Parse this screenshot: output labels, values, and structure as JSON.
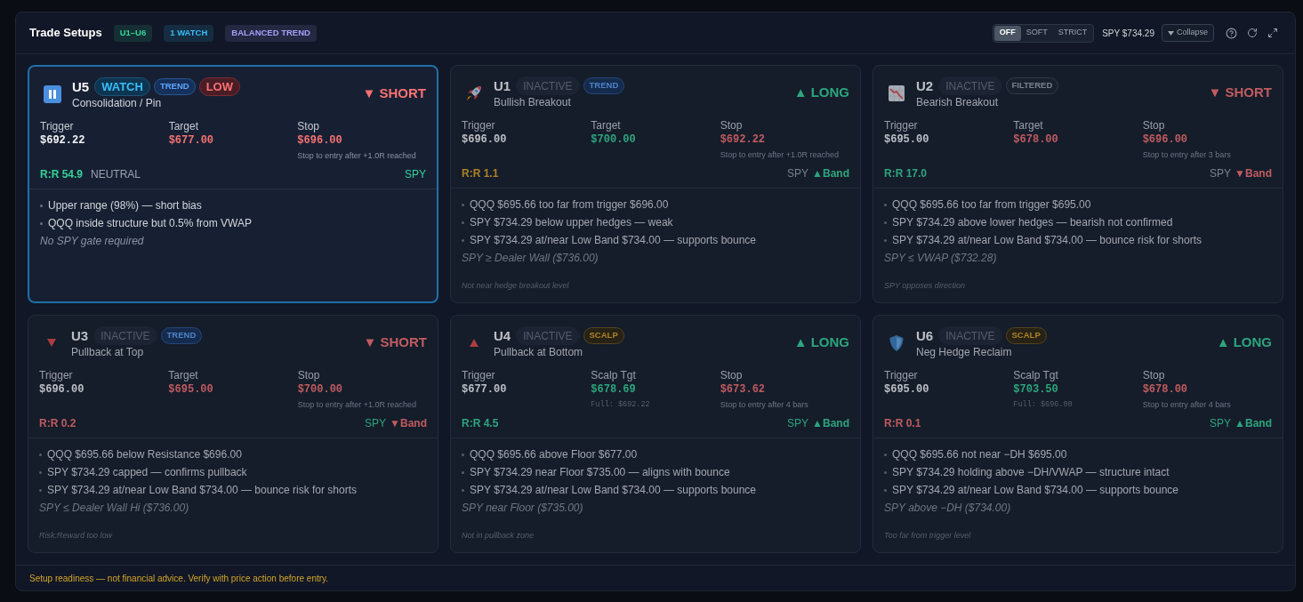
{
  "header": {
    "title": "Trade Setups",
    "badges": [
      {
        "text": "U1–U6",
        "color": "#34d399"
      },
      {
        "text": "1 WATCH",
        "color": "#38bdf8"
      },
      {
        "text": "BALANCED TREND",
        "color": "#a5a0fa"
      }
    ],
    "mode": {
      "options": [
        {
          "label": "OFF",
          "selected": true
        },
        {
          "label": "SOFT",
          "selected": false
        },
        {
          "label": "STRICT",
          "selected": false
        }
      ]
    },
    "price": "SPY $734.29",
    "collapse": "Collapse"
  },
  "cards": [
    {
      "kind": "pin",
      "active": true,
      "code": "U5",
      "badges": [
        {
          "text": "WATCH",
          "kind": "watch"
        },
        {
          "text": "TREND",
          "kind": "trend"
        },
        {
          "text": "LOW",
          "kind": "low"
        }
      ],
      "name": "Consolidation / Pin",
      "direction": {
        "text": "▼ SHORT",
        "kind": "short"
      },
      "levels": [
        {
          "label": "Trigger",
          "value": "$692.22",
          "kind": "neutral"
        },
        {
          "label": "Target",
          "value": "$677.00",
          "kind": "negative"
        },
        {
          "label": "Stop",
          "value": "$696.00",
          "kind": "negative",
          "note": {
            "text": "Stop to entry after +1.0R reached",
            "kind": "rule"
          }
        }
      ],
      "rr": {
        "text": "R:R 54.9",
        "kind": "good"
      },
      "regime": "NEUTRAL",
      "spy": {
        "text": "SPY",
        "kind": "good"
      },
      "reasons": [
        "Upper range (98%) — short bias",
        "QQQ inside structure but 0.5% from VWAP"
      ],
      "gate": "No SPY gate required"
    },
    {
      "kind": "breakout",
      "active": false,
      "code": "U1",
      "badges": [
        {
          "text": "INACTIVE",
          "kind": "inactive"
        },
        {
          "text": "TREND",
          "kind": "trend"
        }
      ],
      "name": "Bullish Breakout",
      "direction": {
        "text": "▲ LONG",
        "kind": "long"
      },
      "levels": [
        {
          "label": "Trigger",
          "value": "$696.00",
          "kind": "neutral"
        },
        {
          "label": "Target",
          "value": "$700.00",
          "kind": "positive"
        },
        {
          "label": "Stop",
          "value": "$692.22",
          "kind": "negative",
          "note": {
            "text": "Stop to entry after +1.0R reached",
            "kind": "rule"
          }
        }
      ],
      "rr": {
        "text": "R:R 1.1",
        "kind": "warn"
      },
      "spy": {
        "text": "SPY",
        "kind": "muted"
      },
      "band": {
        "text": "▲Band",
        "kind": "up"
      },
      "reasons": [
        "QQQ $695.66 too far from trigger $696.00",
        "SPY $734.29 below upper hedges — weak",
        "SPY $734.29 at/near Low Band $734.00 — supports bounce"
      ],
      "gate": "SPY ≥ Dealer Wall ($736.00)",
      "footnote": "Not near hedge breakout level"
    },
    {
      "kind": "breakdown",
      "active": false,
      "code": "U2",
      "badges": [
        {
          "text": "INACTIVE",
          "kind": "inactive"
        },
        {
          "text": "FILTERED",
          "kind": "filtered"
        }
      ],
      "name": "Bearish Breakout",
      "direction": {
        "text": "▼ SHORT",
        "kind": "short"
      },
      "levels": [
        {
          "label": "Trigger",
          "value": "$695.00",
          "kind": "neutral"
        },
        {
          "label": "Target",
          "value": "$678.00",
          "kind": "negative"
        },
        {
          "label": "Stop",
          "value": "$696.00",
          "kind": "negative",
          "note": {
            "text": "Stop to entry after 3 bars",
            "kind": "rule"
          }
        }
      ],
      "rr": {
        "text": "R:R 17.0",
        "kind": "good"
      },
      "spy": {
        "text": "SPY",
        "kind": "muted"
      },
      "band": {
        "text": "▼Band",
        "kind": "down"
      },
      "reasons": [
        "QQQ $695.66 too far from trigger $695.00",
        "SPY $734.29 above lower hedges — bearish not confirmed",
        "SPY $734.29 at/near Low Band $734.00 — bounce risk for shorts"
      ],
      "gate": "SPY ≤ VWAP ($732.28)",
      "footnote": "SPY opposes direction"
    },
    {
      "kind": "top",
      "active": false,
      "code": "U3",
      "badges": [
        {
          "text": "INACTIVE",
          "kind": "inactive"
        },
        {
          "text": "TREND",
          "kind": "trend"
        }
      ],
      "name": "Pullback at Top",
      "direction": {
        "text": "▼ SHORT",
        "kind": "short"
      },
      "levels": [
        {
          "label": "Trigger",
          "value": "$696.00",
          "kind": "neutral"
        },
        {
          "label": "Target",
          "value": "$695.00",
          "kind": "negative"
        },
        {
          "label": "Stop",
          "value": "$700.00",
          "kind": "negative",
          "note": {
            "text": "Stop to entry after +1.0R reached",
            "kind": "rule"
          }
        }
      ],
      "rr": {
        "text": "R:R 0.2",
        "kind": "bad"
      },
      "spy": {
        "text": "SPY",
        "kind": "good"
      },
      "band": {
        "text": "▼Band",
        "kind": "down"
      },
      "reasons": [
        "QQQ $695.66 below Resistance $696.00",
        "SPY $734.29 capped — confirms pullback",
        "SPY $734.29 at/near Low Band $734.00 — bounce risk for shorts"
      ],
      "gate": "SPY ≤ Dealer Wall Hi ($736.00)",
      "footnote": "Risk:Reward too low"
    },
    {
      "kind": "bottom",
      "active": false,
      "code": "U4",
      "badges": [
        {
          "text": "INACTIVE",
          "kind": "inactive"
        },
        {
          "text": "SCALP",
          "kind": "scalp"
        }
      ],
      "name": "Pullback at Bottom",
      "direction": {
        "text": "▲ LONG",
        "kind": "long"
      },
      "levels": [
        {
          "label": "Trigger",
          "value": "$677.00",
          "kind": "neutral"
        },
        {
          "label": "Scalp Tgt",
          "value": "$678.69",
          "kind": "positive",
          "note": {
            "text": "Full: $692.22",
            "kind": "full"
          }
        },
        {
          "label": "Stop",
          "value": "$673.62",
          "kind": "negative",
          "note": {
            "text": "Stop to entry after 4 bars",
            "kind": "rule"
          }
        }
      ],
      "rr": {
        "text": "R:R 4.5",
        "kind": "good"
      },
      "spy": {
        "text": "SPY",
        "kind": "good"
      },
      "band": {
        "text": "▲Band",
        "kind": "up"
      },
      "reasons": [
        "QQQ $695.66 above Floor $677.00",
        "SPY $734.29 near Floor $735.00 — aligns with bounce",
        "SPY $734.29 at/near Low Band $734.00 — supports bounce"
      ],
      "gate": "SPY near Floor ($735.00)",
      "footnote": "Not in pullback zone"
    },
    {
      "kind": "reclaim",
      "active": false,
      "code": "U6",
      "badges": [
        {
          "text": "INACTIVE",
          "kind": "inactive"
        },
        {
          "text": "SCALP",
          "kind": "scalp"
        }
      ],
      "name": "Neg Hedge Reclaim",
      "direction": {
        "text": "▲ LONG",
        "kind": "long"
      },
      "levels": [
        {
          "label": "Trigger",
          "value": "$695.00",
          "kind": "neutral"
        },
        {
          "label": "Scalp Tgt",
          "value": "$703.50",
          "kind": "positive",
          "note": {
            "text": "Full: $696.00",
            "kind": "full"
          }
        },
        {
          "label": "Stop",
          "value": "$678.00",
          "kind": "negative",
          "note": {
            "text": "Stop to entry after 4 bars",
            "kind": "rule"
          }
        }
      ],
      "rr": {
        "text": "R:R 0.1",
        "kind": "bad"
      },
      "spy": {
        "text": "SPY",
        "kind": "good"
      },
      "band": {
        "text": "▲Band",
        "kind": "up"
      },
      "reasons": [
        "QQQ $695.66 not near −DH $695.00",
        "SPY $734.29 holding above −DH/VWAP — structure intact",
        "SPY $734.29 at/near Low Band $734.00 — supports bounce"
      ],
      "gate": "SPY above −DH ($734.00)",
      "footnote": "Too far from trigger level"
    }
  ],
  "footer": "Setup readiness — not financial advice. Verify with price action before entry."
}
